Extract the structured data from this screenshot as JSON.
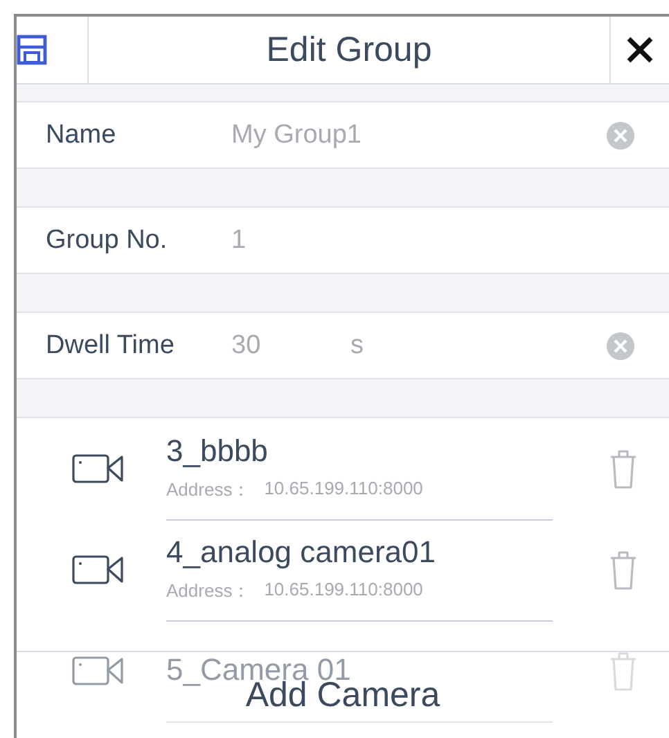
{
  "header": {
    "title": "Edit Group"
  },
  "fields": [
    {
      "kind": "clearable",
      "label": "Name",
      "value": "My Group1"
    },
    {
      "kind": "plain",
      "label": "Group No.",
      "value": "1"
    },
    {
      "kind": "clearable",
      "label": "Dwell Time",
      "value": "30",
      "unit": "s"
    }
  ],
  "cameras": [
    {
      "name": "3_bbbb",
      "address_label": "Address：",
      "address": "10.65.199.110:8000"
    },
    {
      "name": "4_analog camera01",
      "address_label": "Address：",
      "address": "10.65.199.110:8000"
    },
    {
      "name": "5_Camera 01"
    }
  ],
  "footer": {
    "button": "Add Camera"
  }
}
